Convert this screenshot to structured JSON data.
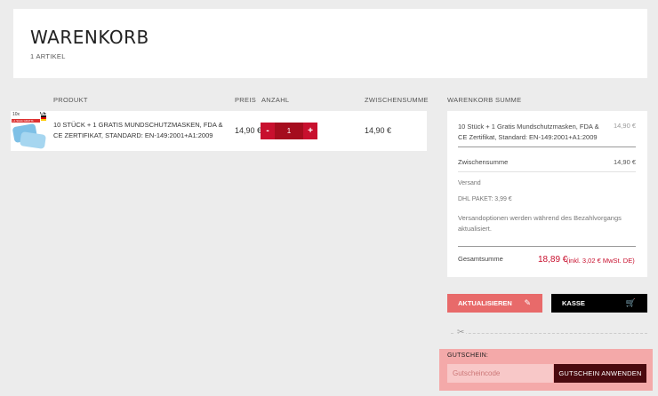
{
  "header": {
    "title": "WARENKORB",
    "items_count": "1 ARTIKEL"
  },
  "table": {
    "columns": {
      "product": "PRODUKT",
      "price": "PREIS",
      "quantity": "ANZAHL",
      "subtotal": "ZWISCHENSUMME"
    },
    "rows": [
      {
        "name": "10 STÜCK + 1 GRATIS MUNDSCHUTZMASKEN, FDA & CE ZERTIFIKAT, STANDARD: EN-149:2001+A1:2009",
        "price": "14,90 €",
        "quantity": "1",
        "minus": "-",
        "plus": "+",
        "subtotal": "14,90 €",
        "thumb_text": "10x",
        "thumb_stripe": "+1 Stück GRATIS",
        "thumb_ce": "CE"
      }
    ]
  },
  "summary": {
    "title": "WARENKORB SUMME",
    "item_name": "10 Stück + 1 Gratis Mundschutzmasken, FDA & CE Zertifikat, Standard: EN-149:2001+A1:2009",
    "item_price": "14,90 €",
    "subtotal_label": "Zwischensumme",
    "subtotal_value": "14,90 €",
    "shipping_label": "Versand",
    "shipping_option": "DHL PAKET: 3,99 €",
    "shipping_note": "Versandoptionen werden während des Bezahlvorgangs aktualisiert.",
    "total_label": "Gesamtsumme",
    "total_value": "18,89 €",
    "total_tax": "(inkl. 3,02 € MwSt. DE)"
  },
  "actions": {
    "update_label": "AKTUALISIEREN",
    "checkout_label": "KASSE"
  },
  "coupon": {
    "label": "GUTSCHEIN:",
    "placeholder": "Gutscheincode",
    "apply_label": "GUTSCHEIN ANWENDEN"
  },
  "colors": {
    "accent": "#c8102e",
    "update_bg": "#e86a6a",
    "coupon_bg": "#f4a9a9",
    "coupon_btn": "#4a0a0f"
  }
}
